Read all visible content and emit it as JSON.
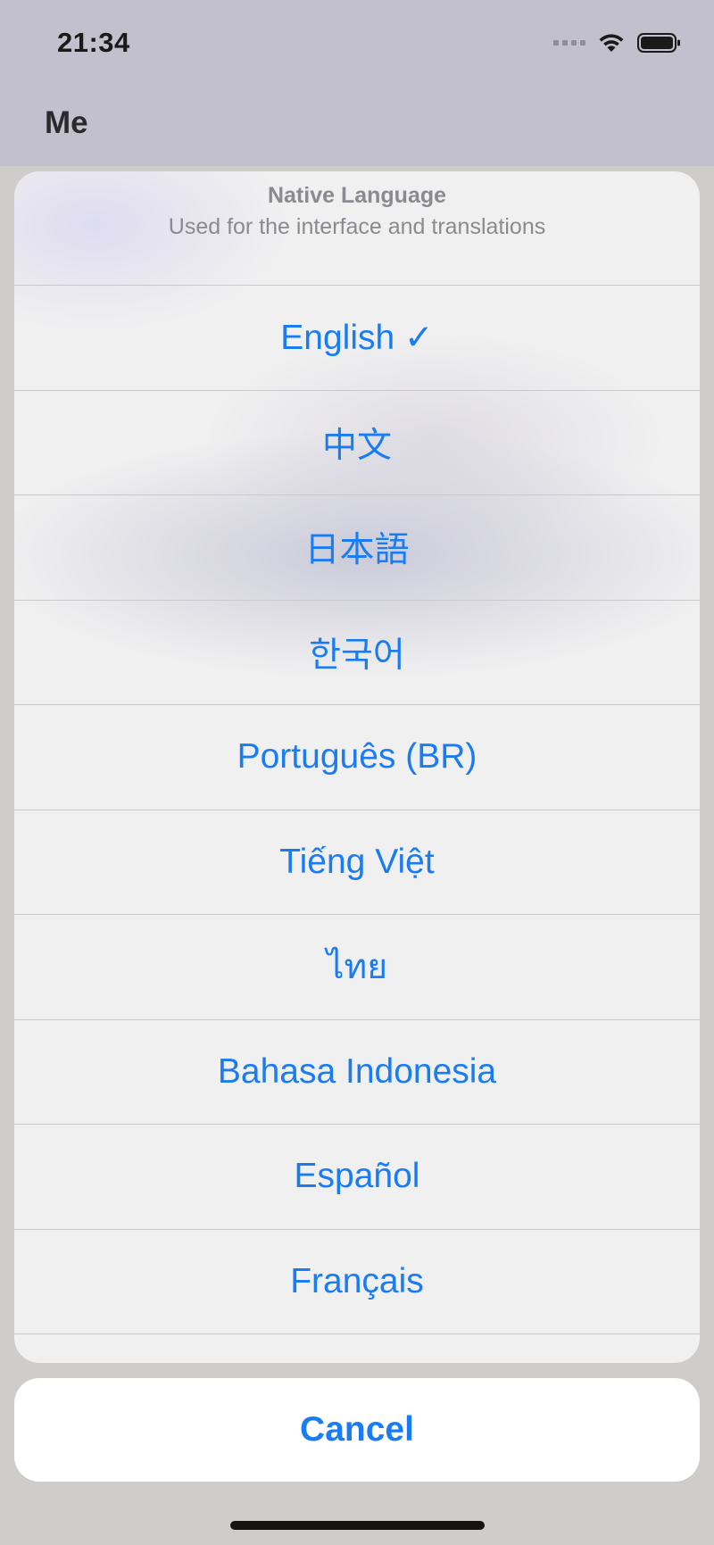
{
  "status_bar": {
    "time": "21:34"
  },
  "nav": {
    "title": "Me"
  },
  "sheet": {
    "title": "Native Language",
    "subtitle": "Used for the interface and translations",
    "options": [
      {
        "label": "English ✓",
        "selected": true
      },
      {
        "label": "中文"
      },
      {
        "label": "日本語"
      },
      {
        "label": "한국어"
      },
      {
        "label": "Português (BR)"
      },
      {
        "label": "Tiếng Việt"
      },
      {
        "label": "ไทย"
      },
      {
        "label": "Bahasa Indonesia"
      },
      {
        "label": "Español"
      },
      {
        "label": "Français"
      }
    ],
    "cancel_label": "Cancel"
  },
  "colors": {
    "accent": "#1a7cf2",
    "sheet_background": "#f1f0f0",
    "header_background": "#c1c0cc"
  },
  "icons": [
    "signal-icon",
    "wifi-icon",
    "battery-icon"
  ]
}
